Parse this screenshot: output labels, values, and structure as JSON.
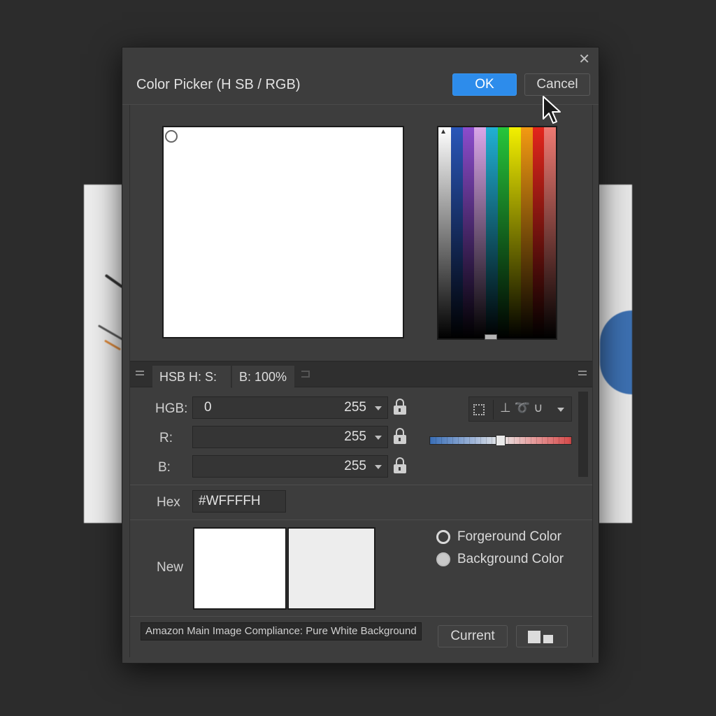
{
  "dialog": {
    "title": "Color Picker (H SB / RGB)",
    "ok_label": "OK",
    "cancel_label": "Cancel",
    "close_glyph": "✕"
  },
  "spectrum": {
    "colors": [
      "#ffffff",
      "#2a56b8",
      "#8b4ccc",
      "#d9a6e8",
      "#21b0d4",
      "#27c63b",
      "#f3f000",
      "#f39a12",
      "#e3261c",
      "#ee7a72"
    ]
  },
  "tabs": {
    "hsb_label": "HSB  H:  S:",
    "b_label": "B: 100%"
  },
  "rows": [
    {
      "label": "HGB:",
      "left_value": "0",
      "value": "255"
    },
    {
      "label": "R:",
      "left_value": "",
      "value": "255"
    },
    {
      "label": "B:",
      "left_value": "",
      "value": "255"
    }
  ],
  "hex": {
    "label": "Hex",
    "value": "#WFFFFH"
  },
  "preview": {
    "label": "New",
    "new_color": "#ffffff",
    "current_color": "#ededed"
  },
  "radios": {
    "foreground_label": "Forgeround Color",
    "background_label": "Background Color",
    "selected": "foreground"
  },
  "footer": {
    "compliance_text": "Amazon Main Image Compliance: Pure White Background",
    "current_label": "Current"
  },
  "icons": {
    "lock": "lock-icon",
    "selection": "marquee-icon",
    "tools_text": "⊥ ➰ ∪"
  },
  "slider": {
    "value": 0.5
  },
  "accent": "#2d8ceb"
}
